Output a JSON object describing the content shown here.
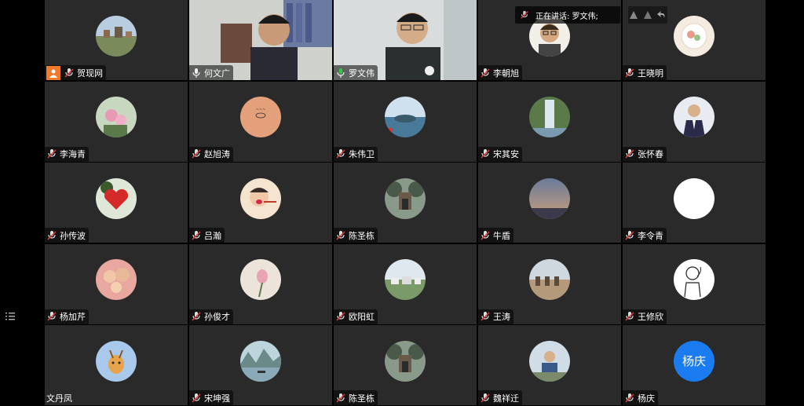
{
  "speaking": {
    "label": "正在讲话: 罗文伟;"
  },
  "participants": [
    {
      "name": "贺现网",
      "avatar": "landscape-village",
      "kind": "avatar",
      "host": true,
      "mic": "muted"
    },
    {
      "name": "何文广",
      "avatar": "video-office-man",
      "kind": "video",
      "mic": "on"
    },
    {
      "name": "罗文伟",
      "avatar": "video-glasses-man",
      "kind": "video",
      "mic": "speaking"
    },
    {
      "name": "李朝旭",
      "avatar": "man-glasses-portrait",
      "kind": "avatar",
      "mic": "muted"
    },
    {
      "name": "王晓明",
      "avatar": "food-plate",
      "kind": "avatar",
      "mic": "muted"
    },
    {
      "name": "李海青",
      "avatar": "pink-flowers",
      "kind": "avatar",
      "mic": "muted"
    },
    {
      "name": "赵旭涛",
      "avatar": "peach-sketch",
      "kind": "avatar",
      "mic": "muted"
    },
    {
      "name": "朱伟卫",
      "avatar": "lake-sky",
      "kind": "avatar",
      "mic": "muted"
    },
    {
      "name": "宋其安",
      "avatar": "waterfall",
      "kind": "avatar",
      "mic": "muted"
    },
    {
      "name": "张怀春",
      "avatar": "man-suit",
      "kind": "avatar",
      "mic": "muted"
    },
    {
      "name": "孙传波",
      "avatar": "red-heart",
      "kind": "avatar",
      "mic": "muted"
    },
    {
      "name": "吕瀚",
      "avatar": "child-cartoon",
      "kind": "avatar",
      "mic": "muted"
    },
    {
      "name": "陈圣栋",
      "avatar": "gate-trees",
      "kind": "avatar",
      "mic": "muted"
    },
    {
      "name": "牛盾",
      "avatar": "dusk-sky",
      "kind": "avatar",
      "mic": "muted"
    },
    {
      "name": "李令青",
      "avatar": "blank-white",
      "kind": "avatar",
      "mic": "muted"
    },
    {
      "name": "杨加芹",
      "avatar": "family-photo",
      "kind": "avatar",
      "mic": "muted"
    },
    {
      "name": "孙俊才",
      "avatar": "flower-bud",
      "kind": "avatar",
      "mic": "muted"
    },
    {
      "name": "欧阳虹",
      "avatar": "village-hills",
      "kind": "avatar",
      "mic": "muted"
    },
    {
      "name": "王涛",
      "avatar": "camels-desert",
      "kind": "avatar",
      "mic": "muted"
    },
    {
      "name": "王修欣",
      "avatar": "line-drawing-person",
      "kind": "avatar",
      "mic": "muted"
    },
    {
      "name": "文丹凤",
      "avatar": "cartoon-deer",
      "kind": "avatar",
      "mic": "none"
    },
    {
      "name": "宋坤强",
      "avatar": "river-boat",
      "kind": "avatar",
      "mic": "muted"
    },
    {
      "name": "陈圣栋",
      "avatar": "gate-trees",
      "kind": "avatar",
      "mic": "muted"
    },
    {
      "name": "魏祥迁",
      "avatar": "man-outdoor",
      "kind": "avatar",
      "mic": "muted"
    },
    {
      "name": "杨庆",
      "avatar": "text-initials",
      "initials": "杨庆",
      "kind": "avatar",
      "mic": "muted"
    }
  ],
  "colors": {
    "tile": "#2a2a2a",
    "host_badge": "#f07a2a",
    "speaking_outline": "#2ea043",
    "initials_bg": "#1a7cf0"
  }
}
